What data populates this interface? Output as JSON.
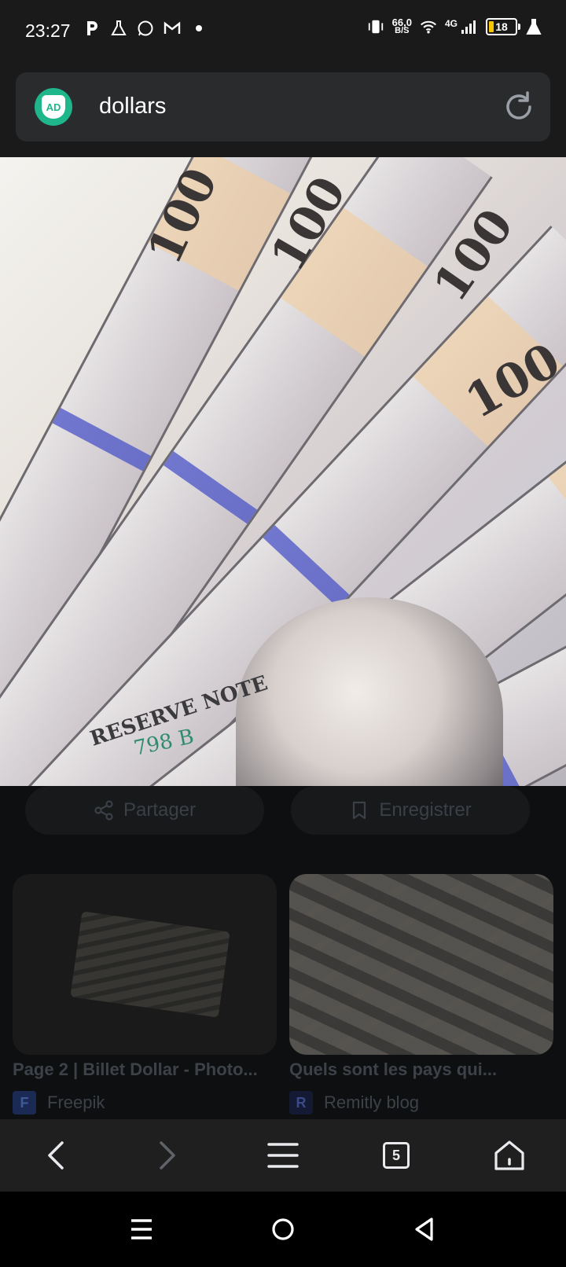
{
  "status_bar": {
    "time": "23:27",
    "left_icons": [
      "parking-icon",
      "lab-flask-icon",
      "whatsapp-icon",
      "gmail-icon",
      "dot-icon"
    ],
    "net_speed_value": "66,0",
    "net_speed_unit": "B/S",
    "network_type": "4G",
    "battery_level": "18"
  },
  "browser": {
    "shield_label": "AD",
    "url_text": "dollars"
  },
  "image_actions": {
    "share_label": "Partager",
    "save_label": "Enregistrer"
  },
  "photo": {
    "bill_denomination": "100",
    "reserve_text": "RESERVE NOTE",
    "serial_fragment": "798 B"
  },
  "related": [
    {
      "title": "Page 2 | Billet Dollar - Photo...",
      "source": "Freepik",
      "logo_color": "#2f5fd9",
      "logo_letter": "F"
    },
    {
      "title": "Quels sont les pays qui...",
      "source": "Remitly blog",
      "logo_color": "#2a3a8f",
      "logo_letter": "R"
    }
  ],
  "toolbar": {
    "tab_count": "5"
  },
  "colors": {
    "accent_shield": "#1eb68a",
    "battery_fill": "#f6c700"
  }
}
